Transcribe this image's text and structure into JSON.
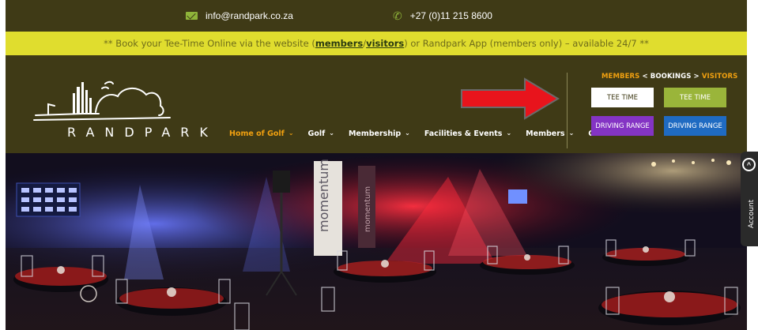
{
  "topbar": {
    "email": "info@randpark.co.za",
    "phone": "+27 (0)11 215 8600"
  },
  "announcement": {
    "prefix": "** Book your Tee-Time Online via the website (",
    "members_link": "members",
    "slash": "/",
    "visitors_link": "visitors",
    "suffix": ") or Randpark App (members only) – available 24/7 **"
  },
  "brand": {
    "name": "RANDPARK"
  },
  "nav": {
    "items": [
      {
        "label": "Home of Golf"
      },
      {
        "label": "Golf"
      },
      {
        "label": "Membership"
      },
      {
        "label": "Facilities & Events"
      },
      {
        "label": "Members"
      },
      {
        "label": "Contact"
      }
    ]
  },
  "bookings": {
    "members": "MEMBERS",
    "lt": "<",
    "label": "BOOKINGS",
    "gt": ">",
    "visitors": "VISITORS",
    "members_tee_time": "TEE TIME",
    "visitors_tee_time": "TEE TIME",
    "members_driving_range": "DRIVING RANGE",
    "visitors_driving_range": "DRIVING RANGE"
  },
  "hero": {
    "banner_text_1": "momentum",
    "banner_text_2": "momentum"
  },
  "account_tab": {
    "label": "Account"
  },
  "colors": {
    "header_bg": "#3f3a16",
    "announcement_bg": "#e0dd2e",
    "accent_orange": "#f0a010",
    "green": "#9ab53a",
    "purple": "#8434c4",
    "blue": "#1f6bc2",
    "arrow_red": "#e8141c"
  },
  "icons": [
    "envelope-icon",
    "phone-icon",
    "chevron-down-icon",
    "red-arrow-icon",
    "chevron-up-icon"
  ]
}
